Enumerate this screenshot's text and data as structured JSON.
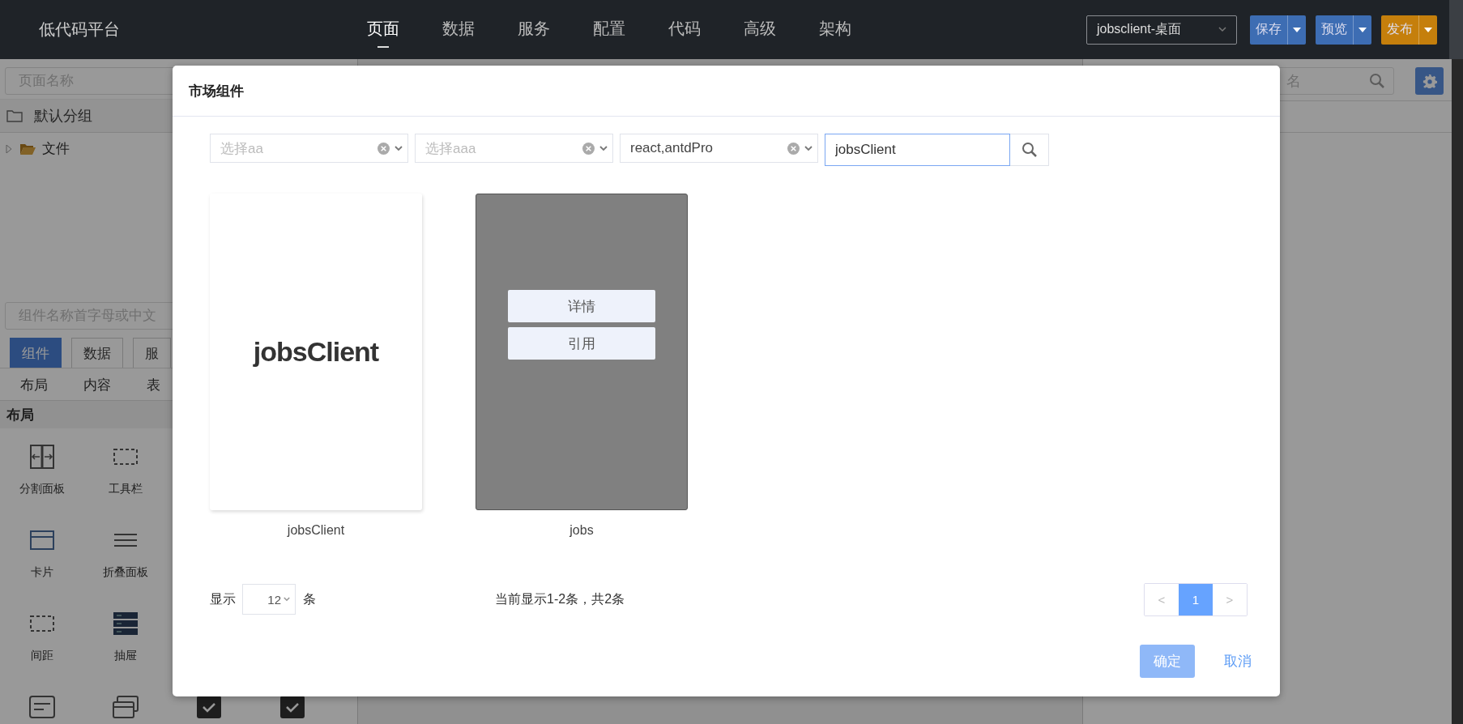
{
  "app": {
    "title": "低代码平台"
  },
  "nav": [
    {
      "label": "页面",
      "selected": true
    },
    {
      "label": "数据",
      "selected": false
    },
    {
      "label": "服务",
      "selected": false
    },
    {
      "label": "配置",
      "selected": false
    },
    {
      "label": "代码",
      "selected": false
    },
    {
      "label": "高级",
      "selected": false
    },
    {
      "label": "架构",
      "selected": false
    }
  ],
  "page_selector": {
    "value": "jobsclient-桌面"
  },
  "toolbar_buttons": [
    {
      "label": "保存",
      "color": "#3d6db3"
    },
    {
      "label": "预览",
      "color": "#3d6db3"
    },
    {
      "label": "发布",
      "color": "#c57f0c"
    }
  ],
  "sidebar": {
    "page_search": {
      "placeholder": "页面名称"
    },
    "group": {
      "label": "默认分组"
    },
    "tree": [
      {
        "label": "文件",
        "expanded": false
      }
    ],
    "component_search": {
      "placeholder": "组件名称首字母或中文"
    },
    "tabs": [
      {
        "label": "组件",
        "selected": true
      },
      {
        "label": "数据",
        "selected": false
      },
      {
        "label": "服",
        "selected": false
      }
    ],
    "categories": [
      "布局",
      "内容",
      "表"
    ],
    "section_title": "布局",
    "component_rows": [
      [
        {
          "kind": "split",
          "label": "分割面板"
        },
        {
          "kind": "toolbar",
          "label": "工具栏"
        }
      ],
      [
        {
          "kind": "card",
          "label": "卡片"
        },
        {
          "kind": "collapse",
          "label": "折叠面板"
        }
      ],
      [
        {
          "kind": "spacer",
          "label": "间距"
        },
        {
          "kind": "drawer",
          "label": "抽屉"
        }
      ],
      [
        {
          "kind": "form"
        },
        {
          "kind": "cards"
        },
        {
          "kind": "checkbox"
        },
        {
          "kind": "checkbox"
        }
      ]
    ]
  },
  "right_panel": {
    "search": {
      "placeholder": "名"
    }
  },
  "modal": {
    "title": "市场组件",
    "filters": [
      {
        "placeholder": "选择aa"
      },
      {
        "placeholder": "选择aaa"
      },
      {
        "value": "react,antdPro"
      }
    ],
    "search": {
      "value": "jobsClient"
    },
    "cards": [
      {
        "name": "jobsClient",
        "preview_text": "jobsClient",
        "hovered": false
      },
      {
        "name": "jobs",
        "hovered": true,
        "actions": [
          "详情",
          "引用"
        ]
      }
    ],
    "page_size": {
      "before": "显示",
      "value": "12",
      "after": "条"
    },
    "summary": "当前显示1-2条，共2条",
    "pagination": {
      "prev": "<",
      "next": ">",
      "pages": [
        {
          "label": "1",
          "selected": true
        }
      ]
    },
    "ok_button": {
      "label": "确定",
      "disabled": true
    },
    "cancel_button": {
      "label": "取消"
    }
  }
}
